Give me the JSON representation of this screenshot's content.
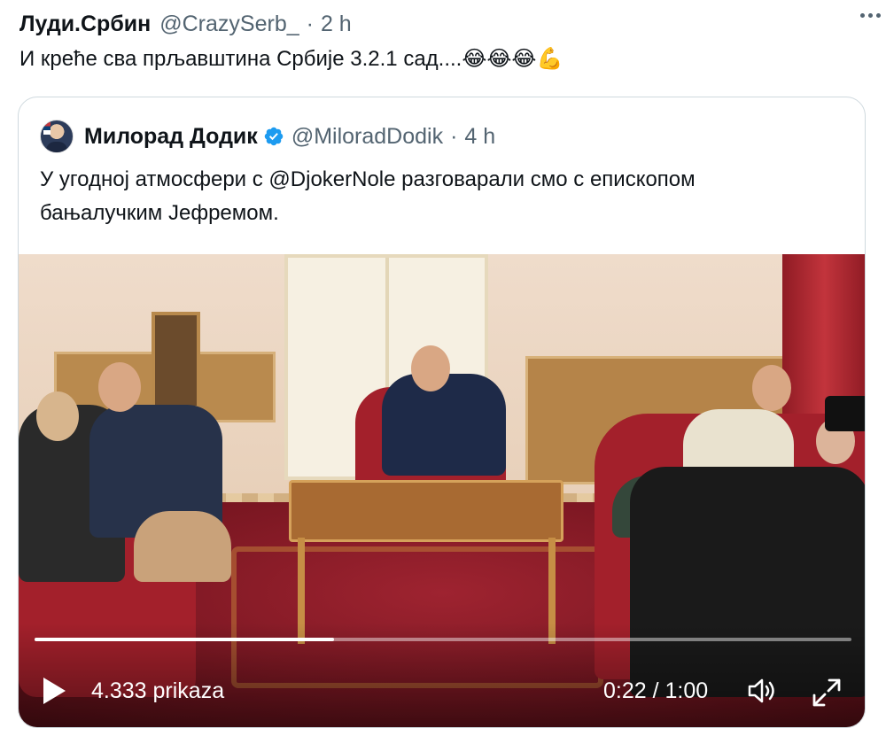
{
  "tweet": {
    "author_name": "Луди.Србин",
    "author_handle": "@CrazySerb_",
    "separator": "·",
    "time": "2 h",
    "text": "И креће сва прљавштина Србије 3.2.1 сад....😂😂😂💪"
  },
  "quoted": {
    "author_name": "Милорад Додик",
    "author_handle": "@MiloradDodik",
    "separator": "·",
    "time": "4 h",
    "verified": true,
    "text_line1": "У угодној атмосфери с @DjokerNole разговарали смо с епископом",
    "text_line2": "бањалучким Јефремом.",
    "video": {
      "views": "4.333 prikaza",
      "timecode": "0:22 / 1:00",
      "progress": 0.367,
      "state": "paused"
    }
  },
  "icons": {
    "more": "more-horizontal-icon",
    "verified": "verified-badge-icon",
    "play": "play-icon",
    "volume": "volume-icon",
    "fullscreen": "fullscreen-icon"
  },
  "colors": {
    "text_primary": "#0f1419",
    "text_secondary": "#536471",
    "verified_blue": "#1d9bf0",
    "card_border": "#cfd9de"
  }
}
